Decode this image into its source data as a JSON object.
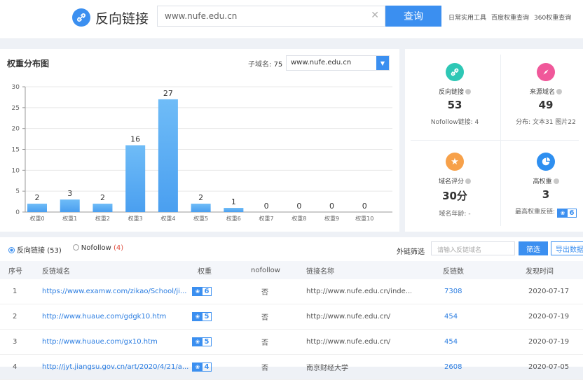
{
  "header": {
    "logo_text": "反向链接",
    "search_value": "www.nufe.edu.cn",
    "search_button": "查询",
    "links": [
      "日常实用工具",
      "百度权重查询",
      "360权重查询"
    ]
  },
  "chart_panel": {
    "title": "权重分布图",
    "subdomain_label": "子域名:",
    "subdomain_count": "75",
    "selected_domain": "www.nufe.edu.cn"
  },
  "chart_data": {
    "type": "bar",
    "categories": [
      "权重0",
      "权重1",
      "权重2",
      "权重3",
      "权重4",
      "权重5",
      "权重6",
      "权重7",
      "权重8",
      "权重9",
      "权重10"
    ],
    "values": [
      2,
      3,
      2,
      16,
      27,
      2,
      1,
      0,
      0,
      0,
      0
    ],
    "yticks": [
      0,
      5,
      10,
      15,
      20,
      25,
      30
    ],
    "ylim": [
      0,
      30
    ],
    "bar_color": "#4a9ff0"
  },
  "stats": {
    "backlinks": {
      "label": "反向链接",
      "value": "53",
      "sub": "Nofollow链接: 4",
      "icon": "link-icon",
      "color": "#2ec7b5"
    },
    "source_domains": {
      "label": "来源域名",
      "value": "49",
      "sub": "分布: 文本31 图片22",
      "icon": "compass-icon",
      "color": "#f0589a"
    },
    "domain_score": {
      "label": "域名评分",
      "value": "30分",
      "sub": "域名年龄: -",
      "icon": "star-icon",
      "color": "#f7a14a"
    },
    "high_weight": {
      "label": "高权重",
      "value": "3",
      "sub": "最高权重反链:",
      "badge": "6",
      "icon": "pie-icon",
      "color": "#2e8ff0"
    }
  },
  "table": {
    "tab_backlinks": "反向链接",
    "tab_backlinks_count": "(53)",
    "tab_nofollow": "Nofollow",
    "tab_nofollow_count": "(4)",
    "filter_label": "外链筛选",
    "filter_placeholder": "请输入反链域名",
    "filter_button": "筛选",
    "export_button": "导出数据",
    "columns": [
      "序号",
      "反链域名",
      "权重",
      "nofollow",
      "链接名称",
      "反链数",
      "发现时间"
    ],
    "rows": [
      {
        "idx": "1",
        "domain": "https://www.examw.com/zikao/School/ji...",
        "weight": "6",
        "nofollow": "否",
        "name": "http://www.nufe.edu.cn/inde...",
        "count": "7308",
        "date": "2020-07-17"
      },
      {
        "idx": "2",
        "domain": "http://www.huaue.com/gdgk10.htm",
        "weight": "5",
        "nofollow": "否",
        "name": "http://www.nufe.edu.cn/",
        "count": "454",
        "date": "2020-07-19"
      },
      {
        "idx": "3",
        "domain": "http://www.huaue.com/gx10.htm",
        "weight": "5",
        "nofollow": "否",
        "name": "http://www.nufe.edu.cn/",
        "count": "454",
        "date": "2020-07-19"
      },
      {
        "idx": "4",
        "domain": "http://jyt.jiangsu.gov.cn/art/2020/4/21/a...",
        "weight": "4",
        "nofollow": "否",
        "name": "南京财经大学",
        "count": "2608",
        "date": "2020-07-05"
      }
    ]
  }
}
